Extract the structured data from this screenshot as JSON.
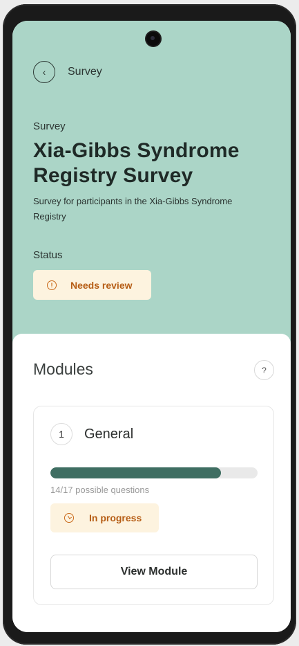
{
  "header": {
    "back_icon": "chevron-left-icon",
    "back_label": "Survey"
  },
  "survey": {
    "eyebrow": "Survey",
    "title": "Xia-Gibbs Syndrome Registry Survey",
    "description": "Survey for participants in the Xia-Gibbs Syndrome Registry",
    "status_label": "Status",
    "status": {
      "icon": "alert-circle-icon",
      "text": "Needs review",
      "color": "#b65d15",
      "background": "#fdf3df"
    }
  },
  "modules_section": {
    "title": "Modules",
    "help_icon": "question-mark-icon",
    "help_symbol": "?",
    "modules": [
      {
        "number": "1",
        "name": "General",
        "answered": 14,
        "total": 17,
        "progress_fraction": 0.8235,
        "progress_text": "14/17 possible questions",
        "status_icon": "clock-icon",
        "status_text": "In progress",
        "action_label": "View Module"
      }
    ]
  },
  "colors": {
    "hero_background": "#abd5c7",
    "progress_fill": "#3f6e62",
    "progress_track": "#e9e9e9"
  }
}
